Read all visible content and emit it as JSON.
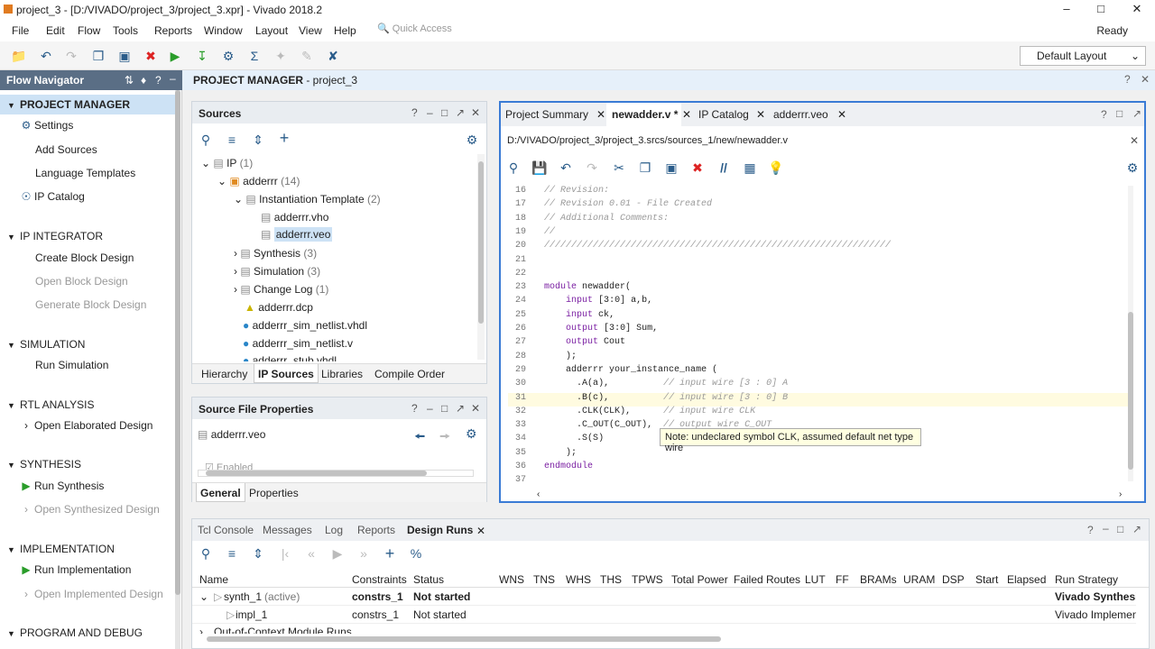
{
  "window": {
    "title": "project_3 - [D:/VIVADO/project_3/project_3.xpr] - Vivado 2018.2"
  },
  "menu": [
    "File",
    "Edit",
    "Flow",
    "Tools",
    "Reports",
    "Window",
    "Layout",
    "View",
    "Help"
  ],
  "quick_access": "Quick Access",
  "status": "Ready",
  "layout_select": "Default Layout",
  "flow_navigator": {
    "title": "Flow Navigator",
    "sections": {
      "project_manager": {
        "label": "PROJECT MANAGER",
        "items": [
          "Settings",
          "Add Sources",
          "Language Templates",
          "IP Catalog"
        ]
      },
      "ip_integrator": {
        "label": "IP INTEGRATOR",
        "items": [
          "Create Block Design",
          "Open Block Design",
          "Generate Block Design"
        ]
      },
      "simulation": {
        "label": "SIMULATION",
        "items": [
          "Run Simulation"
        ]
      },
      "rtl": {
        "label": "RTL ANALYSIS",
        "items": [
          "Open Elaborated Design"
        ]
      },
      "synthesis": {
        "label": "SYNTHESIS",
        "items": [
          "Run Synthesis",
          "Open Synthesized Design"
        ]
      },
      "implementation": {
        "label": "IMPLEMENTATION",
        "items": [
          "Run Implementation",
          "Open Implemented Design"
        ]
      },
      "program": {
        "label": "PROGRAM AND DEBUG"
      }
    }
  },
  "pm_header": {
    "bold": "PROJECT MANAGER",
    "rest": " - project_3"
  },
  "sources": {
    "title": "Sources",
    "tree": [
      {
        "label": "IP",
        "count": "(1)"
      },
      {
        "label": "adderrr",
        "count": "(14)"
      },
      {
        "label": "Instantiation Template",
        "count": "(2)"
      },
      {
        "label": "adderrr.vho",
        "count": ""
      },
      {
        "label": "adderrr.veo",
        "count": ""
      },
      {
        "label": "Synthesis",
        "count": "(3)"
      },
      {
        "label": "Simulation",
        "count": "(3)"
      },
      {
        "label": "Change Log",
        "count": "(1)"
      },
      {
        "label": "adderrr.dcp",
        "count": ""
      },
      {
        "label": "adderrr_sim_netlist.vhdl",
        "count": ""
      },
      {
        "label": "adderrr_sim_netlist.v",
        "count": ""
      },
      {
        "label": "adderrr_stub.vhdl",
        "count": ""
      }
    ],
    "tabs": [
      "Hierarchy",
      "IP Sources",
      "Libraries",
      "Compile Order"
    ]
  },
  "sfp": {
    "title": "Source File Properties",
    "file": "adderrr.veo",
    "enabled": "Enabled",
    "tabs": [
      "General",
      "Properties"
    ]
  },
  "editor": {
    "tabs": [
      "Project Summary",
      "newadder.v *",
      "IP Catalog",
      "adderrr.veo"
    ],
    "path": "D:/VIVADO/project_3/project_3.srcs/sources_1/new/newadder.v",
    "lines": [
      {
        "n": "16",
        "t": "// Revision:"
      },
      {
        "n": "17",
        "t": "// Revision 0.01 - File Created"
      },
      {
        "n": "18",
        "t": "// Additional Comments:"
      },
      {
        "n": "19",
        "t": "//"
      },
      {
        "n": "20",
        "t": "////////////////////////////////////////////////////////////////"
      },
      {
        "n": "21",
        "t": ""
      },
      {
        "n": "22",
        "t": ""
      },
      {
        "n": "23",
        "t": "module newadder("
      },
      {
        "n": "24",
        "t": "    input [3:0] a,b,"
      },
      {
        "n": "25",
        "t": "    input ck,"
      },
      {
        "n": "26",
        "t": "    output [3:0] Sum,"
      },
      {
        "n": "27",
        "t": "    output Cout"
      },
      {
        "n": "28",
        "t": "    );"
      },
      {
        "n": "29",
        "t": "    adderrr your_instance_name ("
      },
      {
        "n": "30",
        "t": "      .A(a),          // input wire [3 : 0] A"
      },
      {
        "n": "31",
        "t": "      .B(c),          // input wire [3 : 0] B"
      },
      {
        "n": "32",
        "t": "      .CLK(CLK),      // input wire CLK"
      },
      {
        "n": "33",
        "t": "      .C_OUT(C_OUT),  // output wire C_OUT"
      },
      {
        "n": "34",
        "t": "      .S(S)           //"
      },
      {
        "n": "35",
        "t": "    );"
      },
      {
        "n": "36",
        "t": "endmodule"
      },
      {
        "n": "37",
        "t": ""
      }
    ],
    "tooltip": "Note: undeclared symbol CLK, assumed default net type wire"
  },
  "bottom": {
    "tabs": [
      "Tcl Console",
      "Messages",
      "Log",
      "Reports",
      "Design Runs"
    ],
    "columns": [
      "Name",
      "Constraints",
      "Status",
      "WNS",
      "TNS",
      "WHS",
      "THS",
      "TPWS",
      "Total Power",
      "Failed Routes",
      "LUT",
      "FF",
      "BRAMs",
      "URAM",
      "DSP",
      "Start",
      "Elapsed",
      "Run Strategy"
    ],
    "rows": [
      {
        "name": "synth_1",
        "extra": "(active)",
        "constraints": "constrs_1",
        "status": "Not started",
        "strategy": "Vivado Synthesis D"
      },
      {
        "name": "impl_1",
        "extra": "",
        "constraints": "constrs_1",
        "status": "Not started",
        "strategy": "Vivado Implementati"
      },
      {
        "name": "Out-of-Context Module Runs",
        "extra": "",
        "constraints": "",
        "status": "",
        "strategy": ""
      }
    ]
  }
}
